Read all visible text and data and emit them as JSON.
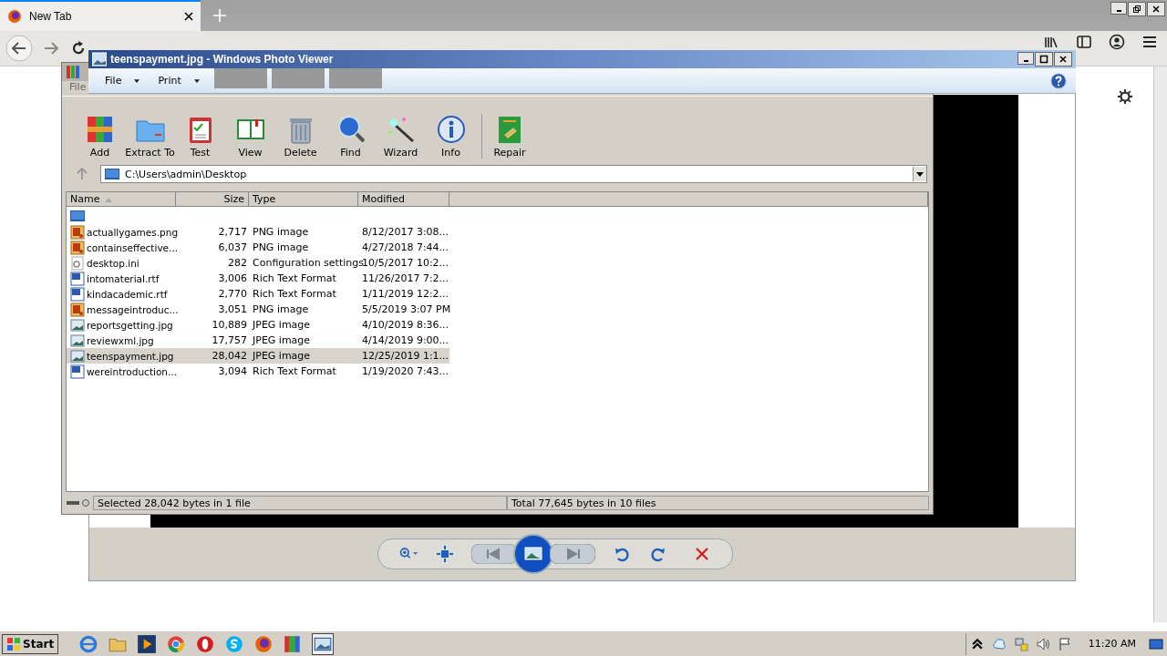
{
  "browser": {
    "tab": {
      "title": "New Tab",
      "selected": true
    }
  },
  "archiver": {
    "menu": [
      "File"
    ],
    "toolbar": [
      "Add",
      "Extract To",
      "Test",
      "View",
      "Delete",
      "Find",
      "Wizard",
      "Info",
      "Repair"
    ],
    "address": "C:\\Users\\admin\\Desktop",
    "columns": [
      "Name",
      "Size",
      "Type",
      "Modified"
    ],
    "rows": [
      {
        "kind": "up",
        "name": "",
        "size": "",
        "type": "",
        "modified": "",
        "selected": false
      },
      {
        "kind": "png",
        "name": "actuallygames.png",
        "size": "2,717",
        "type": "PNG image",
        "modified": "8/12/2017 3:08...",
        "selected": false
      },
      {
        "kind": "png",
        "name": "containseffective...",
        "size": "6,037",
        "type": "PNG image",
        "modified": "4/27/2018 7:44...",
        "selected": false
      },
      {
        "kind": "ini",
        "name": "desktop.ini",
        "size": "282",
        "type": "Configuration settings",
        "modified": "10/5/2017 10:2...",
        "selected": false
      },
      {
        "kind": "rtf",
        "name": "intomaterial.rtf",
        "size": "3,006",
        "type": "Rich Text Format",
        "modified": "11/26/2017 7:2...",
        "selected": false
      },
      {
        "kind": "rtf",
        "name": "kindacademic.rtf",
        "size": "2,770",
        "type": "Rich Text Format",
        "modified": "1/11/2019 12:2...",
        "selected": false
      },
      {
        "kind": "png",
        "name": "messageintroduc...",
        "size": "3,051",
        "type": "PNG image",
        "modified": "5/5/2019 3:07 PM",
        "selected": false
      },
      {
        "kind": "jpg",
        "name": "reportsgetting.jpg",
        "size": "10,889",
        "type": "JPEG image",
        "modified": "4/10/2019 8:36...",
        "selected": false
      },
      {
        "kind": "jpg",
        "name": "reviewxml.jpg",
        "size": "17,757",
        "type": "JPEG image",
        "modified": "4/14/2019 9:00...",
        "selected": false
      },
      {
        "kind": "jpg",
        "name": "teenspayment.jpg",
        "size": "28,042",
        "type": "JPEG image",
        "modified": "12/25/2019 1:1...",
        "selected": true
      },
      {
        "kind": "rtf",
        "name": "wereintroduction...",
        "size": "3,094",
        "type": "Rich Text Format",
        "modified": "1/19/2020 7:43...",
        "selected": false
      }
    ],
    "status_left": "Selected 28,042 bytes in 1 file",
    "status_right": "Total 77,645 bytes in 10 files"
  },
  "viewer": {
    "title": "teenspayment.jpg - Windows Photo Viewer",
    "menu": [
      "File",
      "Print"
    ]
  },
  "taskbar": {
    "start": "Start",
    "clock": "11:20 AM"
  }
}
